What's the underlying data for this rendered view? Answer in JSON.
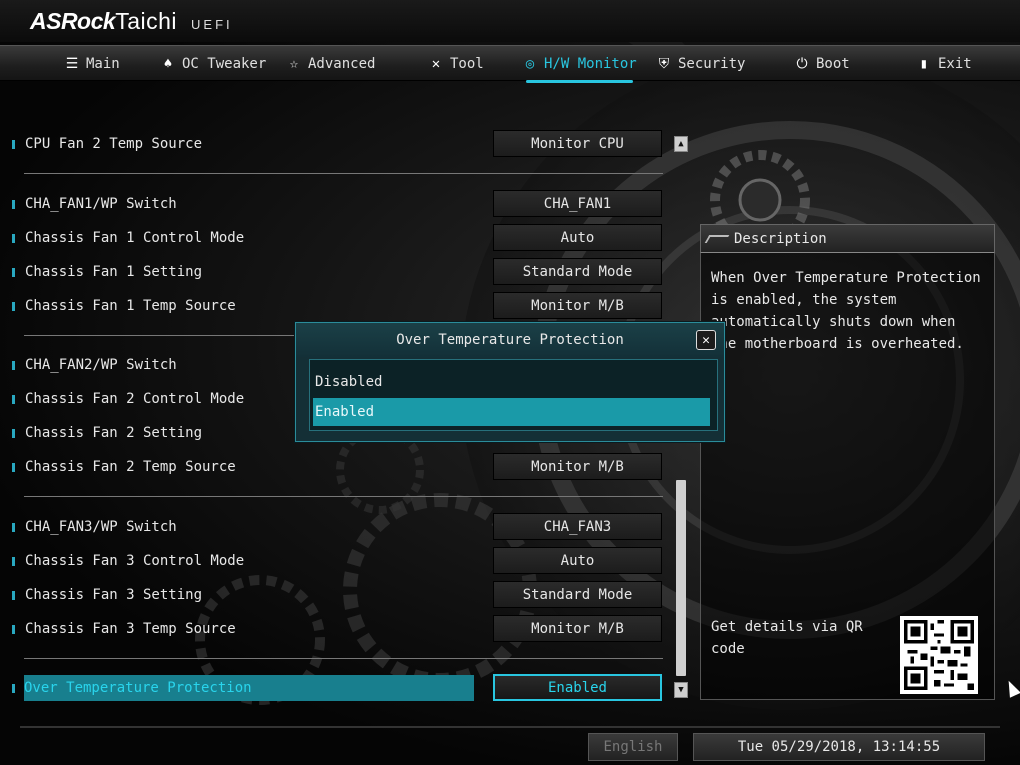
{
  "brand": {
    "name_bold": "ASRock",
    "name": "Taichi",
    "edition": "UEFI"
  },
  "tabs": [
    {
      "label": "Main",
      "icon": "list-icon"
    },
    {
      "label": "OC Tweaker",
      "icon": "flame-icon"
    },
    {
      "label": "Advanced",
      "icon": "star-icon"
    },
    {
      "label": "Tool",
      "icon": "tools-icon"
    },
    {
      "label": "H/W Monitor",
      "icon": "globe-icon"
    },
    {
      "label": "Security",
      "icon": "shield-icon"
    },
    {
      "label": "Boot",
      "icon": "power-icon"
    },
    {
      "label": "Exit",
      "icon": "exit-door-icon"
    }
  ],
  "active_tab": "H/W Monitor",
  "settings": [
    {
      "label": "CPU Fan 2 Temp Source",
      "value": "Monitor CPU"
    },
    {
      "label": "CHA_FAN1/WP Switch",
      "value": "CHA_FAN1"
    },
    {
      "label": "Chassis Fan 1 Control Mode",
      "value": "Auto"
    },
    {
      "label": "Chassis Fan 1 Setting",
      "value": "Standard Mode"
    },
    {
      "label": "Chassis Fan 1 Temp Source",
      "value": "Monitor M/B"
    },
    {
      "label": "CHA_FAN2/WP Switch",
      "value": ""
    },
    {
      "label": "Chassis Fan 2 Control Mode",
      "value": ""
    },
    {
      "label": "Chassis Fan 2 Setting",
      "value": ""
    },
    {
      "label": "Chassis Fan 2 Temp Source",
      "value": "Monitor M/B"
    },
    {
      "label": "CHA_FAN3/WP Switch",
      "value": "CHA_FAN3"
    },
    {
      "label": "Chassis Fan 3 Control Mode",
      "value": "Auto"
    },
    {
      "label": "Chassis Fan 3 Setting",
      "value": "Standard Mode"
    },
    {
      "label": "Chassis Fan 3 Temp Source",
      "value": "Monitor M/B"
    },
    {
      "label": "Over Temperature Protection",
      "value": "Enabled"
    }
  ],
  "description": {
    "heading": "Description",
    "text": "When Over Temperature Protection is enabled, the system automatically shuts down when the motherboard is overheated.",
    "qr_label": "Get details via QR code"
  },
  "popup": {
    "title": "Over Temperature Protection",
    "options": [
      "Disabled",
      "Enabled"
    ],
    "selected": "Enabled"
  },
  "footer": {
    "language": "English",
    "datetime": "Tue 05/29/2018, 13:14:55"
  },
  "colors": {
    "accent": "#29c6e0",
    "selected_row": "#187f8e",
    "popup_bg": "#142f36"
  }
}
